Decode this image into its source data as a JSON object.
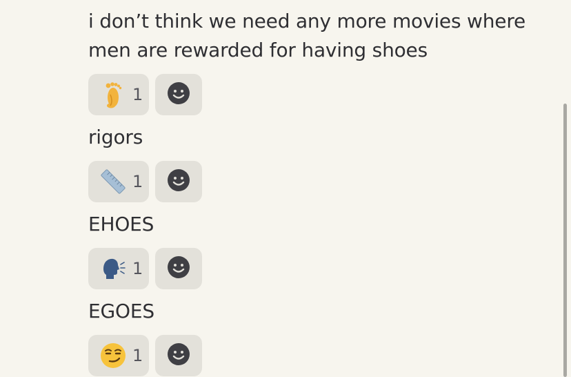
{
  "messages": [
    {
      "text": "i don’t think we need any more movies where men are rewarded for having shoes",
      "reaction": {
        "emoji": "foot-emoji",
        "count": "1"
      }
    },
    {
      "text": "rigors",
      "reaction": {
        "emoji": "ruler-emoji",
        "count": "1"
      }
    },
    {
      "text": "EHOES",
      "reaction": {
        "emoji": "speaking-head-emoji",
        "count": "1"
      }
    },
    {
      "text": "EGOES",
      "reaction": {
        "emoji": "smirking-face-emoji",
        "count": "1"
      }
    }
  ],
  "add_reaction_icon": "smiley-add-reaction-icon",
  "colors": {
    "background": "#f7f5ee",
    "pill": "#e3e1da",
    "text": "#2f2f33",
    "smiley": "#3f3f44"
  }
}
